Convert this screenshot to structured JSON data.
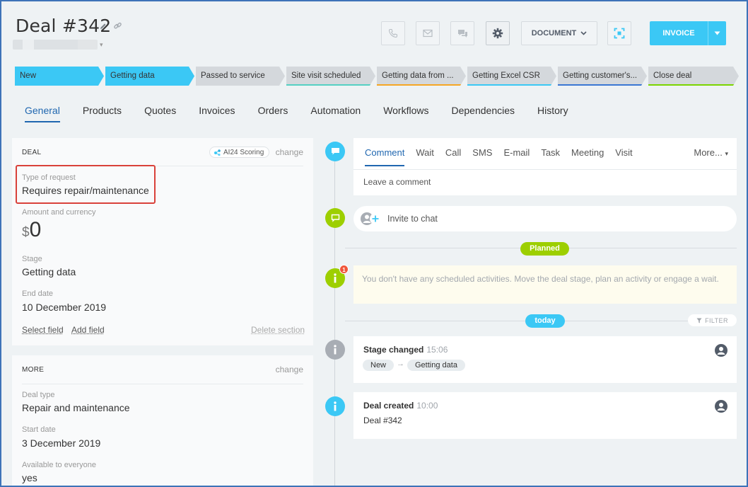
{
  "header": {
    "title": "Deal #342",
    "document_label": "DOCUMENT",
    "invoice_label": "INVOICE"
  },
  "stages": [
    {
      "label": "New",
      "active": true,
      "underline": ""
    },
    {
      "label": "Getting data",
      "active": true,
      "underline": ""
    },
    {
      "label": "Passed to service",
      "active": false,
      "underline": ""
    },
    {
      "label": "Site visit scheduled",
      "active": false,
      "underline": "#55d0c2"
    },
    {
      "label": "Getting data from ...",
      "active": false,
      "underline": "#f5a623"
    },
    {
      "label": "Getting Excel CSR",
      "active": false,
      "underline": "#3bc8f5"
    },
    {
      "label": "Getting customer's...",
      "active": false,
      "underline": "#3b77d3"
    },
    {
      "label": "Close deal",
      "active": false,
      "underline": "#7bd500"
    }
  ],
  "tabs": [
    "General",
    "Products",
    "Quotes",
    "Invoices",
    "Orders",
    "Automation",
    "Workflows",
    "Dependencies",
    "History"
  ],
  "deal_card": {
    "heading": "DEAL",
    "scoring": "AI24 Scoring",
    "change": "change",
    "type_label": "Type of request",
    "type_value": "Requires repair/maintenance",
    "amount_label": "Amount and currency",
    "currency": "$",
    "amount": "0",
    "stage_label": "Stage",
    "stage_value": "Getting data",
    "end_label": "End date",
    "end_value": "10 December 2019",
    "select_field": "Select field",
    "add_field": "Add field",
    "delete_section": "Delete section"
  },
  "more_card": {
    "heading": "MORE",
    "change": "change",
    "deal_type_label": "Deal type",
    "deal_type_value": "Repair and maintenance",
    "start_label": "Start date",
    "start_value": "3 December 2019",
    "avail_label": "Available to everyone",
    "avail_value": "yes"
  },
  "composer": {
    "tabs": [
      "Comment",
      "Wait",
      "Call",
      "SMS",
      "E-mail",
      "Task",
      "Meeting",
      "Visit"
    ],
    "more": "More...",
    "placeholder": "Leave a comment"
  },
  "timeline": {
    "invite": "Invite to chat",
    "planned": "Planned",
    "notice_badge": "1",
    "notice": "You don't have any scheduled activities. Move the deal stage, plan an activity or engage a wait.",
    "today": "today",
    "filter": "FILTER",
    "event1_title": "Stage changed",
    "event1_time": "15:06",
    "event1_from": "New",
    "event1_to": "Getting data",
    "event2_title": "Deal created",
    "event2_time": "10:00",
    "event2_sub": "Deal #342"
  },
  "colors": {
    "accent": "#3bc8f5",
    "link": "#2067b0",
    "green": "#9dcf00",
    "highlight": "#d9413a"
  }
}
